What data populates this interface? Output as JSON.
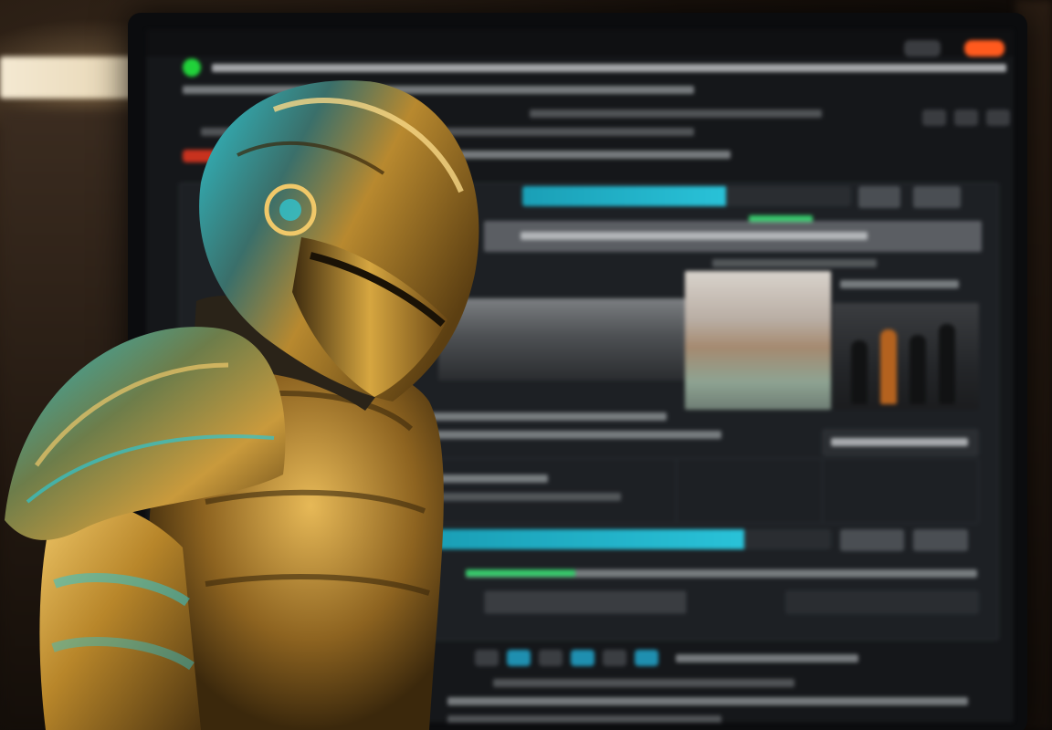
{
  "scene": {
    "description_tag": "",
    "colors": {
      "armor_gold": "#b8862a",
      "armor_teal": "#2fc4cf",
      "screen_accent": "#29c2d8",
      "status_green": "#21d23a",
      "alert_orange": "#ff5a1e"
    },
    "icons": [
      "knight-figure",
      "status-dot-icon"
    ]
  },
  "screen": {
    "progress_top": 0.62,
    "progress_bottom": 0.78
  }
}
